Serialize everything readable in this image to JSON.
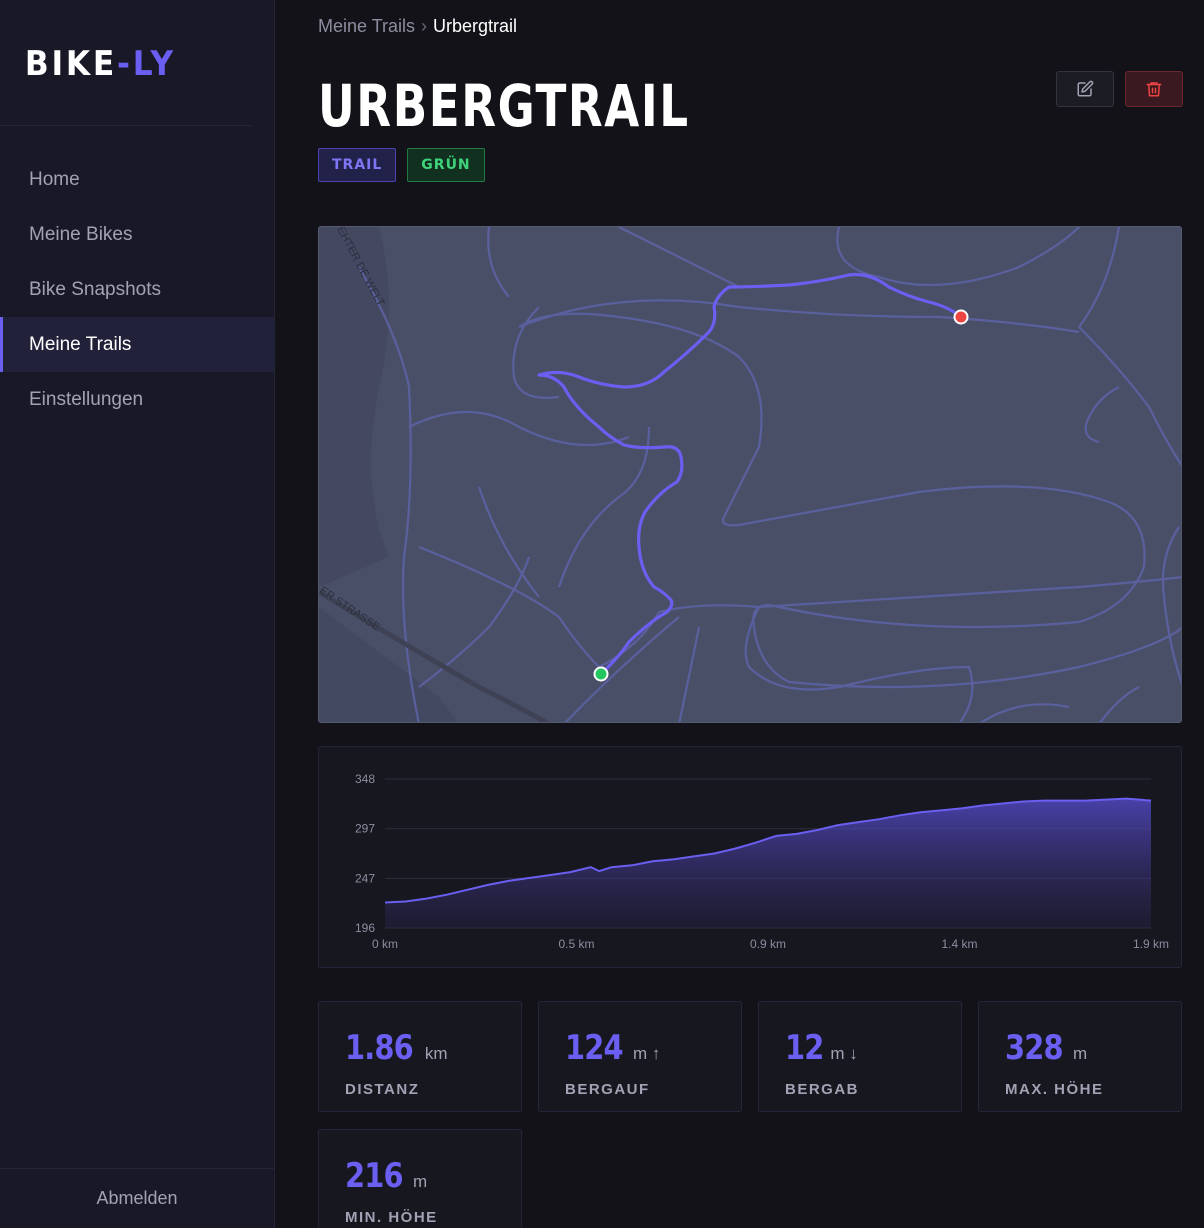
{
  "app": {
    "logo_part1": "BIKE",
    "logo_part2": "-LY"
  },
  "sidebar": {
    "items": [
      {
        "label": "Home"
      },
      {
        "label": "Meine Bikes"
      },
      {
        "label": "Bike Snapshots"
      },
      {
        "label": "Meine Trails",
        "active": true
      },
      {
        "label": "Einstellungen"
      }
    ],
    "logout_label": "Abmelden"
  },
  "breadcrumb": {
    "parent": "Meine Trails",
    "separator": "›",
    "current": "Urbergtrail"
  },
  "trail": {
    "title": "URBERGTRAIL",
    "tags": [
      {
        "label": "TRAIL"
      },
      {
        "label": "GRÜN"
      }
    ]
  },
  "actions": {
    "edit_icon": "edit-icon",
    "delete_icon": "trash-icon"
  },
  "map": {
    "street_labels": [
      "ER STRASSE",
      "EHTER DE WELT"
    ],
    "start_marker_color": "#22c55e",
    "end_marker_color": "#ef4444",
    "route_color": "#6a5ff0"
  },
  "chart_data": {
    "type": "area",
    "title": "",
    "xlabel": "",
    "ylabel": "",
    "x_ticks": [
      "0 km",
      "0.5 km",
      "0.9 km",
      "1.4 km",
      "1.9 km"
    ],
    "y_ticks": [
      "348",
      "297",
      "247",
      "196"
    ],
    "ylim": [
      196,
      348
    ],
    "xlim": [
      0,
      1.86
    ],
    "grid": true,
    "series": [
      {
        "x": [
          0,
          0.05,
          0.1,
          0.15,
          0.2,
          0.25,
          0.3,
          0.35,
          0.4,
          0.45,
          0.5,
          0.52,
          0.55,
          0.6,
          0.65,
          0.7,
          0.75,
          0.8,
          0.85,
          0.9,
          0.95,
          1.0,
          1.05,
          1.1,
          1.15,
          1.2,
          1.25,
          1.3,
          1.35,
          1.4,
          1.45,
          1.5,
          1.55,
          1.6,
          1.65,
          1.7,
          1.75,
          1.8,
          1.86
        ],
        "y": [
          222,
          223,
          226,
          230,
          235,
          240,
          244,
          247,
          250,
          253,
          258,
          254,
          258,
          260,
          264,
          266,
          269,
          272,
          277,
          283,
          290,
          292,
          296,
          301,
          304,
          307,
          311,
          314,
          316,
          318,
          321,
          323,
          325,
          326,
          326,
          326,
          327,
          328,
          326
        ]
      }
    ]
  },
  "stats": [
    {
      "value": "1.86",
      "unit": "km",
      "arrow": "",
      "label": "DISTANZ"
    },
    {
      "value": "124",
      "unit": "m",
      "arrow": "↑",
      "label": "BERGAUF"
    },
    {
      "value": "12",
      "unit": "m",
      "arrow": "↓",
      "label": "BERGAB"
    },
    {
      "value": "328",
      "unit": "m",
      "arrow": "",
      "label": "MAX. HÖHE"
    },
    {
      "value": "216",
      "unit": "m",
      "arrow": "",
      "label": "MIN. HÖHE"
    }
  ],
  "colors": {
    "accent": "#6a5ff0",
    "background": "#121218",
    "sidebar": "#181827"
  }
}
